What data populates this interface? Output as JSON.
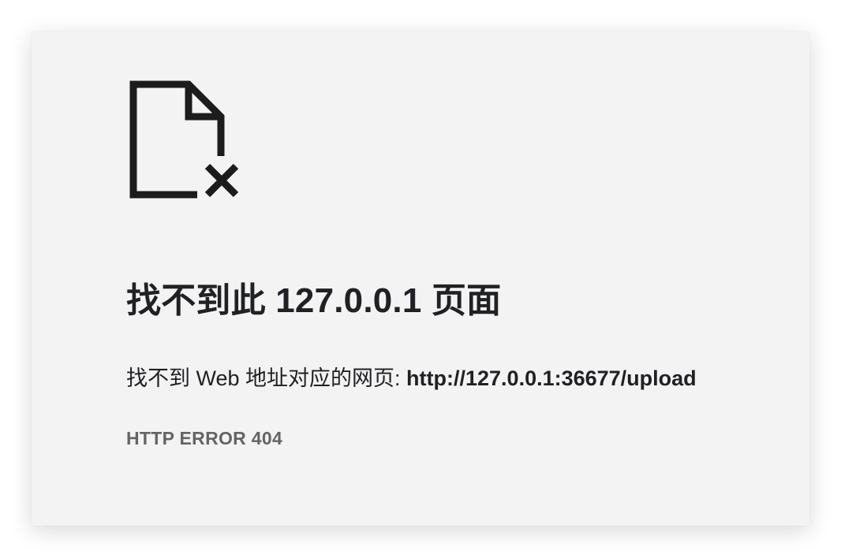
{
  "icon": "file-not-found-icon",
  "error": {
    "title": "找不到此 127.0.0.1 页面",
    "description_prefix": "找不到 Web 地址对应的网页: ",
    "url": "http://127.0.0.1:36677/upload",
    "code": "HTTP ERROR 404"
  },
  "colors": {
    "background": "#f3f3f3",
    "text": "#202124",
    "error_code": "#646464"
  }
}
